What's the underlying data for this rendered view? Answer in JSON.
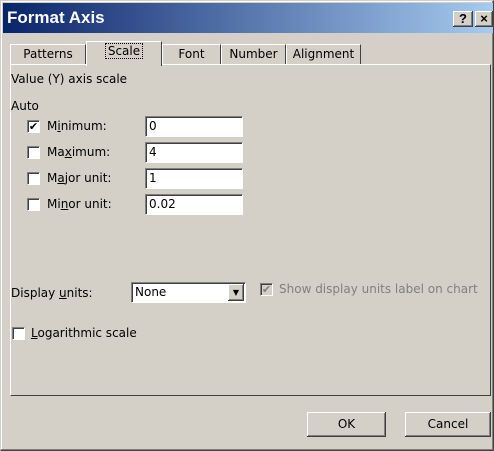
{
  "window": {
    "title": "Format Axis",
    "help_glyph": "?",
    "close_glyph": "×"
  },
  "tabs": [
    {
      "label": "Patterns",
      "active": false
    },
    {
      "label": "Scale",
      "active": true
    },
    {
      "label": "Font",
      "active": false
    },
    {
      "label": "Number",
      "active": false
    },
    {
      "label": "Alignment",
      "active": false
    }
  ],
  "scale": {
    "heading": "Value (Y) axis scale",
    "auto_label": "Auto",
    "rows": [
      {
        "label": "Minimum:",
        "auto_checked": true,
        "value": "0"
      },
      {
        "label": "Maximum:",
        "auto_checked": false,
        "value": "4"
      },
      {
        "label": "Major unit:",
        "auto_checked": false,
        "value": "1"
      },
      {
        "label": "Minor unit:",
        "auto_checked": false,
        "value": "0.02"
      }
    ],
    "display_units_label": "Display units:",
    "display_units_value": "None",
    "show_units_label": "Show display units label on chart",
    "show_units_checked": true,
    "log_scale_label": "Logarithmic scale",
    "log_scale_checked": false
  },
  "buttons": {
    "ok": "OK",
    "cancel": "Cancel"
  },
  "icons": {
    "check": "✔",
    "dropdown": "▼"
  }
}
